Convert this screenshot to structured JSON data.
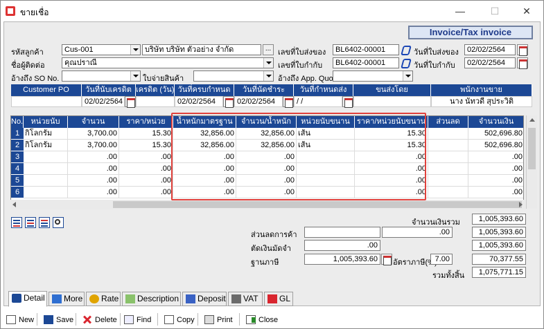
{
  "window": {
    "title": "ขายเชื่อ",
    "minimize": "—",
    "maximize": "☐",
    "close": "✕"
  },
  "doc_title": "Invoice/Tax invoice",
  "header": {
    "customer_code_label": "รหัสลูกค้า",
    "customer_code": "Cus-001",
    "customer_name": "บริษัท บริษัท ตัวอย่าง จำกัด",
    "dots": "...",
    "contact_label": "ชื่อผู้ติดต่อ",
    "contact": "คุณปราณี",
    "so_ref_label": "อ้างถึง SO No.",
    "so_ref": "",
    "goods_slip_label": "ใบจ่ายสินค้า",
    "goods_slip": "",
    "delivery_no_label": "เลขที่ใบส่งของ",
    "delivery_no": "BL6402-00001",
    "tax_no_label": "เลขที่ใบกำกับ",
    "tax_no": "BL6402-00001",
    "quo_ref_label": "อ้างถึง App. Quo.",
    "quo_ref": "",
    "delivery_date_label": "วันที่ใบส่งของ",
    "delivery_date": "02/02/2564",
    "tax_date_label": "วันที่ใบกำกับ",
    "tax_date": "02/02/2564"
  },
  "info_bar": {
    "headers": [
      "Customer PO",
      "วันที่นับเครดิต",
      "เครดิต (วัน)",
      "วันที่ครบกำหนด",
      "วันที่นัดชำระ",
      "วันที่กำหนดส่ง",
      "ขนส่งโดย",
      "พนักงานขาย"
    ],
    "values": {
      "customer_po": "",
      "credit_start": "02/02/2564",
      "credit_days": "",
      "due_date": "02/02/2564",
      "pay_date": "02/02/2564",
      "ship_date": " / /",
      "shipper": "",
      "salesperson": "นาง นัทวดี สุประวิติ"
    }
  },
  "grid": {
    "columns": [
      "No.",
      "หน่วยนับ",
      "จำนวน",
      "ราคา/หน่วย",
      "น้ำหนักมาตรฐาน",
      "จำนวน/น้ำหนัก",
      "หน่วยนับขนาน",
      "ราคา/หน่วยนับขนาน",
      "ส่วนลด",
      "จำนวนเงิน"
    ],
    "rows": [
      {
        "no": "1",
        "unit": "กิโลกรัม",
        "qty": "3,700.00",
        "price": "15.30",
        "std_weight": "32,856.00",
        "qty_weight": "32,856.00",
        "alt_unit": "เส้น",
        "alt_price": "15.30",
        "discount": "",
        "amount": "502,696.80"
      },
      {
        "no": "2",
        "unit": "กิโลกรัม",
        "qty": "3,700.00",
        "price": "15.30",
        "std_weight": "32,856.00",
        "qty_weight": "32,856.00",
        "alt_unit": "เส้น",
        "alt_price": "15.30",
        "discount": "",
        "amount": "502,696.80"
      },
      {
        "no": "3",
        "unit": "",
        "qty": ".00",
        "price": ".00",
        "std_weight": ".00",
        "qty_weight": ".00",
        "alt_unit": "",
        "alt_price": ".00",
        "discount": "",
        "amount": ".00"
      },
      {
        "no": "4",
        "unit": "",
        "qty": ".00",
        "price": ".00",
        "std_weight": ".00",
        "qty_weight": ".00",
        "alt_unit": "",
        "alt_price": ".00",
        "discount": "",
        "amount": ".00"
      },
      {
        "no": "5",
        "unit": "",
        "qty": ".00",
        "price": ".00",
        "std_weight": ".00",
        "qty_weight": ".00",
        "alt_unit": "",
        "alt_price": ".00",
        "discount": "",
        "amount": ".00"
      },
      {
        "no": "6",
        "unit": "",
        "qty": ".00",
        "price": ".00",
        "std_weight": ".00",
        "qty_weight": ".00",
        "alt_unit": "",
        "alt_price": ".00",
        "discount": "",
        "amount": ".00"
      }
    ]
  },
  "totals": {
    "total_label": "จำนวนเงินรวม",
    "total": "1,005,393.60",
    "trade_discount_label": "ส่วนลดการค้า",
    "trade_discount_input": "",
    "trade_discount_amount": ".00",
    "after_discount": "1,005,393.60",
    "deposit_label": "ตัดเงินมัดจำ",
    "deposit_amount": ".00",
    "after_deposit": "1,005,393.60",
    "tax_base_label": "ฐานภาษี",
    "tax_base": "1,005,393.60",
    "vat_rate_label": "อัตราภาษี(%)",
    "vat_rate": "7.00",
    "vat_amount": "70,377.55",
    "grand_total_label": "รวมทั้งสิ้น",
    "grand_total": "1,075,771.15"
  },
  "tabs": [
    {
      "label": "Detail",
      "icon": "detail-icon"
    },
    {
      "label": "More",
      "icon": "more-icon"
    },
    {
      "label": "Rate",
      "icon": "rate-icon"
    },
    {
      "label": "Description",
      "icon": "description-icon"
    },
    {
      "label": "Deposit",
      "icon": "deposit-icon"
    },
    {
      "label": "VAT",
      "icon": "vat-icon"
    },
    {
      "label": "GL",
      "icon": "gl-icon"
    }
  ],
  "toolbar": {
    "new": "New",
    "save": "Save",
    "delete": "Delete",
    "find": "Find",
    "copy": "Copy",
    "print": "Print",
    "close": "Close"
  }
}
